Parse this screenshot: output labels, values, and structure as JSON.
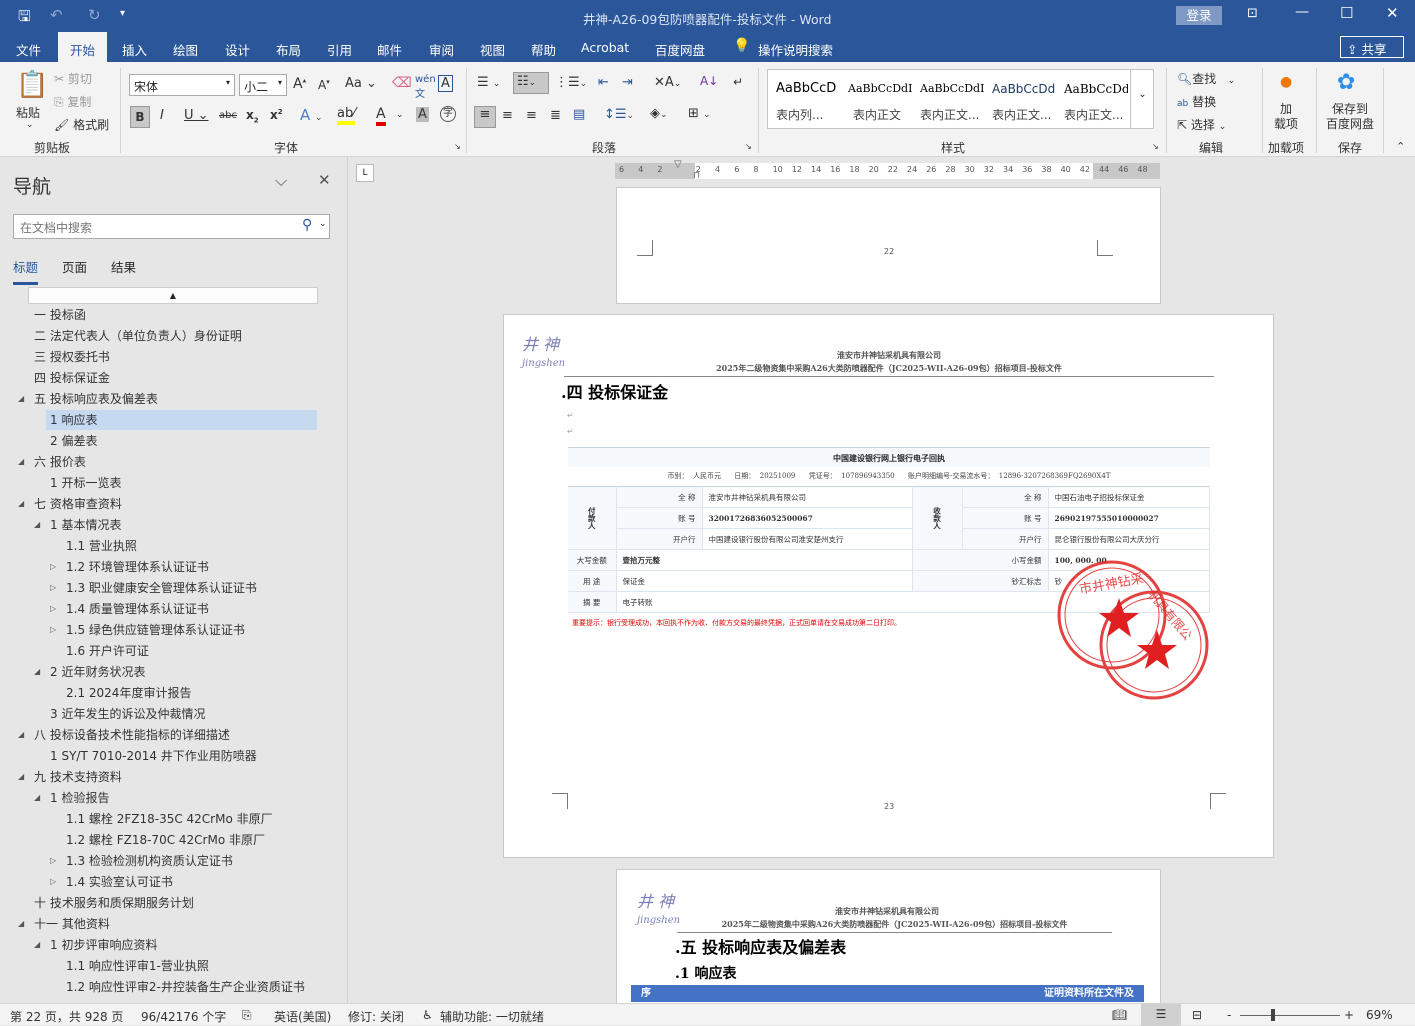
{
  "titlebar": {
    "title": "井神-A26-09包防喷器配件-投标文件  -  Word",
    "login": "登录"
  },
  "tabs": [
    "文件",
    "开始",
    "插入",
    "绘图",
    "设计",
    "布局",
    "引用",
    "邮件",
    "审阅",
    "视图",
    "帮助",
    "Acrobat",
    "百度网盘"
  ],
  "tell_me": "操作说明搜索",
  "share": "共享",
  "ribbon": {
    "clipboard": {
      "paste": "粘贴",
      "cut": "剪切",
      "copy": "复制",
      "format_painter": "格式刷",
      "label": "剪贴板"
    },
    "font": {
      "name": "宋体",
      "size": "小二",
      "label": "字体"
    },
    "paragraph": {
      "label": "段落"
    },
    "styles": {
      "label": "样式",
      "items": [
        {
          "preview": "AaBbCcD",
          "name": "表内列..."
        },
        {
          "preview": "AaBbCcDdI",
          "name": "表内正文"
        },
        {
          "preview": "AaBbCcDdI",
          "name": "表内正文..."
        },
        {
          "preview": "AaBbCcDd",
          "name": "表内正文..."
        },
        {
          "preview": "AaBbCcDd",
          "name": "表内正文..."
        }
      ]
    },
    "editing": {
      "find": "查找",
      "replace": "替换",
      "select": "选择",
      "label": "编辑"
    },
    "addins": {
      "btn": "加\n载项",
      "label": "加载项"
    },
    "save": {
      "btn": "保存到\n百度网盘",
      "label": "保存"
    }
  },
  "nav": {
    "title": "导航",
    "search_placeholder": "在文档中搜索",
    "tabs": [
      "标题",
      "页面",
      "结果"
    ],
    "items": [
      {
        "t": "一 投标函",
        "l": 0,
        "a": ""
      },
      {
        "t": "二 法定代表人（单位负责人）身份证明",
        "l": 0,
        "a": ""
      },
      {
        "t": "三 授权委托书",
        "l": 0,
        "a": ""
      },
      {
        "t": "四 投标保证金",
        "l": 0,
        "a": ""
      },
      {
        "t": "五 投标响应表及偏差表",
        "l": 0,
        "a": "open"
      },
      {
        "t": "1 响应表",
        "l": 1,
        "a": "",
        "sel": true
      },
      {
        "t": "2 偏差表",
        "l": 1,
        "a": ""
      },
      {
        "t": "六 报价表",
        "l": 0,
        "a": "open"
      },
      {
        "t": "1 开标一览表",
        "l": 1,
        "a": ""
      },
      {
        "t": "七 资格审查资料",
        "l": 0,
        "a": "open"
      },
      {
        "t": "1 基本情况表",
        "l": 1,
        "a": "open"
      },
      {
        "t": "1.1 营业执照",
        "l": 2,
        "a": ""
      },
      {
        "t": "1.2 环境管理体系认证证书",
        "l": 2,
        "a": "closed"
      },
      {
        "t": "1.3 职业健康安全管理体系认证证书",
        "l": 2,
        "a": "closed"
      },
      {
        "t": "1.4 质量管理体系认证证书",
        "l": 2,
        "a": "closed"
      },
      {
        "t": "1.5 绿色供应链管理体系认证证书",
        "l": 2,
        "a": "closed"
      },
      {
        "t": "1.6 开户许可证",
        "l": 2,
        "a": ""
      },
      {
        "t": "2 近年财务状况表",
        "l": 1,
        "a": "open"
      },
      {
        "t": "2.1 2024年度审计报告",
        "l": 2,
        "a": ""
      },
      {
        "t": "3 近年发生的诉讼及仲裁情况",
        "l": 1,
        "a": ""
      },
      {
        "t": "八 投标设备技术性能指标的详细描述",
        "l": 0,
        "a": "open"
      },
      {
        "t": "1 SY/T 7010-2014 井下作业用防喷器",
        "l": 1,
        "a": ""
      },
      {
        "t": "九 技术支持资料",
        "l": 0,
        "a": "open"
      },
      {
        "t": "1 检验报告",
        "l": 1,
        "a": "open"
      },
      {
        "t": "1.1 螺栓 2FZ18-35C 42CrMo 非原厂",
        "l": 2,
        "a": ""
      },
      {
        "t": "1.2 螺栓 FZ18-70C 42CrMo 非原厂",
        "l": 2,
        "a": ""
      },
      {
        "t": "1.3 检验检测机构资质认定证书",
        "l": 2,
        "a": "closed"
      },
      {
        "t": "1.4 实验室认可证书",
        "l": 2,
        "a": "closed"
      },
      {
        "t": "十 技术服务和质保期服务计划",
        "l": 0,
        "a": ""
      },
      {
        "t": "十一 其他资料",
        "l": 0,
        "a": "open"
      },
      {
        "t": "1 初步评审响应资料",
        "l": 1,
        "a": "open"
      },
      {
        "t": "1.1 响应性评审1-营业执照",
        "l": 2,
        "a": ""
      },
      {
        "t": "1.2 响应性评审2-井控装备生产企业资质证书",
        "l": 2,
        "a": ""
      }
    ]
  },
  "ruler": [
    "6",
    "4",
    "2",
    "",
    "2",
    "4",
    "6",
    "8",
    "10",
    "12",
    "14",
    "16",
    "18",
    "20",
    "22",
    "24",
    "26",
    "28",
    "30",
    "32",
    "34",
    "36",
    "38",
    "40",
    "42",
    "44",
    "46",
    "48"
  ],
  "doc": {
    "page22_num": "22",
    "page23_num": "23",
    "header_company": "淮安市井神钻采机具有限公司",
    "header_project": "2025年二级物资集中采购A26大类防喷器配件（JC2025-WII-A26-09包）招标项目-投标文件",
    "logo": "井神 jingshen",
    "heading4": ".四 投标保证金",
    "heading5": ".五 投标响应表及偏差表",
    "heading5_1": ".1 响应表",
    "table_cut_left": "序",
    "table_cut_right": "证明资料所在文件及",
    "receipt": {
      "title": "中国建设银行网上银行电子回执",
      "meta": "币别：  人民币元      日期：  20251009      凭证号：  107896943350      账户明细编号-交易流水号：  12896-3207268369FQ2690X4T",
      "payer": "付款人",
      "payee": "收款人",
      "name_label": "全 称",
      "acct_label": "账 号",
      "bank_label": "开户行",
      "payer_name": "淮安市井神钻采机具有限公司",
      "payer_acct": "32001726836052500067",
      "payer_bank": "中国建设银行股份有限公司淮安楚州支行",
      "payee_name": "中国石油电子招投标保证金",
      "payee_acct": "26902197555010000027",
      "payee_bank": "昆仑银行股份有限公司大庆分行",
      "amt_cn_label": "大写金额",
      "amt_cn": "壹拾万元整",
      "amt_label": "小写金额",
      "amt": "100, 000. 00",
      "use_label": "用 途",
      "use": "保证金",
      "cash_label": "钞汇标志",
      "cash": "钞",
      "memo_label": "摘 要",
      "memo": "电子转账",
      "notice": "重要提示：银行受理成功，本回执不作为收、付款方交易的最终凭据，正式回单请在交易成功第二日打印。",
      "stamp": "淮安市井神钻采机具有限公司"
    }
  },
  "status": {
    "page": "第 22 页，共 928 页",
    "words": "96/42176 个字",
    "lang": "英语(美国)",
    "track": "修订: 关闭",
    "access": "辅助功能: 一切就绪",
    "zoom": "69%"
  }
}
